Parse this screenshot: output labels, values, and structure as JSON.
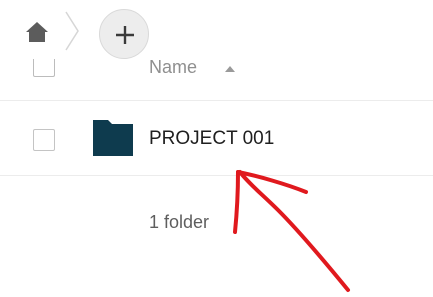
{
  "toolbar": {
    "home_icon": "home-icon",
    "separator_icon": "chevron-right-icon",
    "add_icon": "plus-icon"
  },
  "table": {
    "columns": [
      {
        "label": "Name",
        "sort": "ascending"
      }
    ],
    "rows": [
      {
        "type": "folder",
        "name": "PROJECT 001",
        "icon": "folder-icon"
      }
    ],
    "summary": "1 folder"
  },
  "colors": {
    "folder": "#0e3b4e",
    "annotation_arrow": "#e0191e",
    "add_button_bg": "#ededed"
  }
}
